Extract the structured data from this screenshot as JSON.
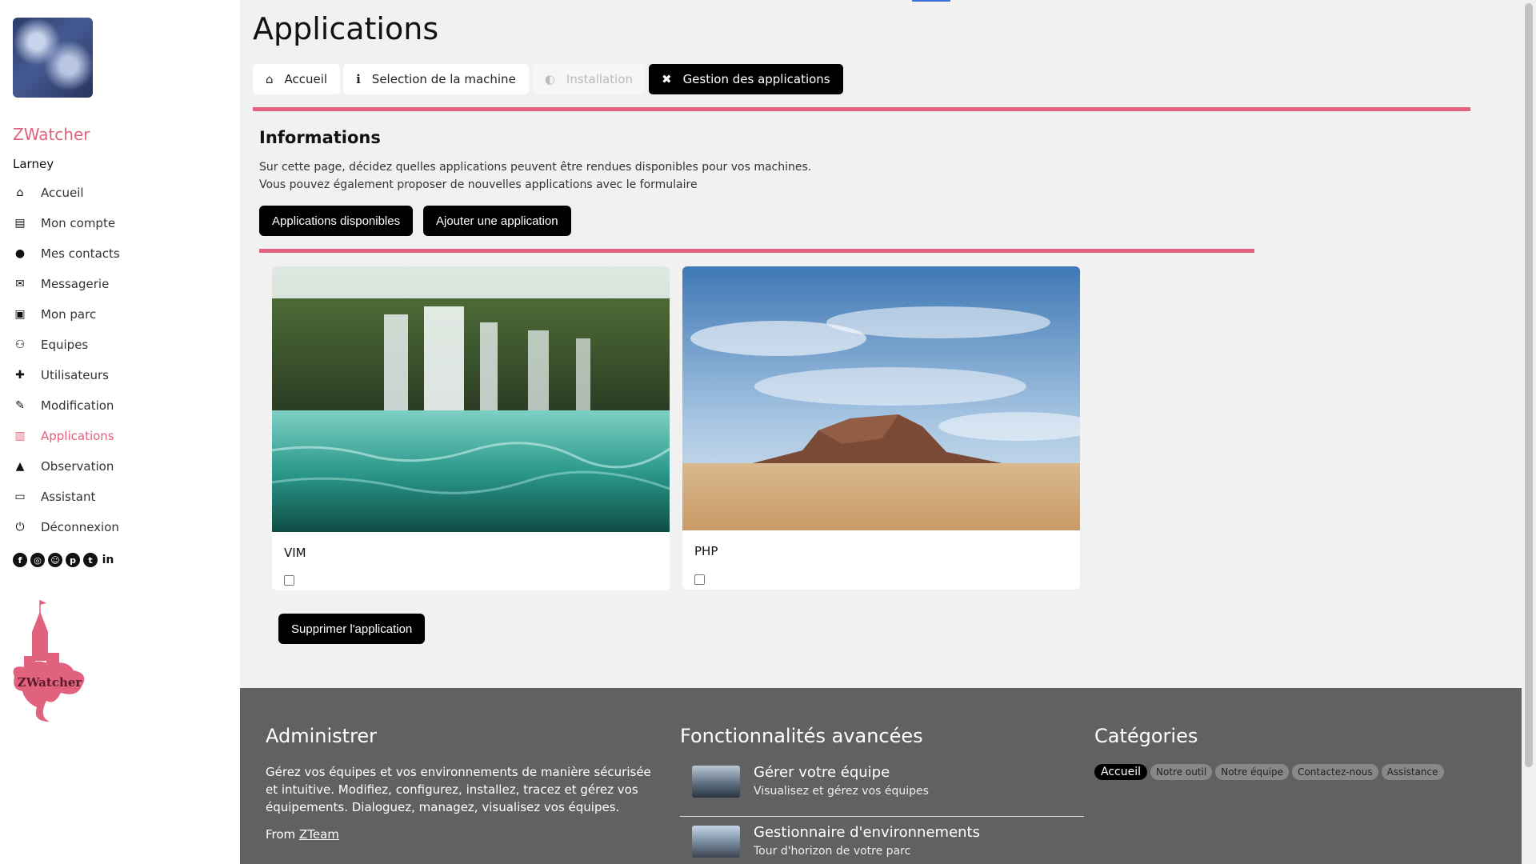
{
  "app": {
    "brand": "ZWatcher",
    "user": "Larney"
  },
  "sidebar": {
    "items": [
      {
        "label": "Accueil",
        "icon": "home-icon"
      },
      {
        "label": "Mon compte",
        "icon": "id-card-icon"
      },
      {
        "label": "Mes contacts",
        "icon": "user-icon"
      },
      {
        "label": "Messagerie",
        "icon": "envelope-icon"
      },
      {
        "label": "Mon parc",
        "icon": "book-icon"
      },
      {
        "label": "Equipes",
        "icon": "users-icon"
      },
      {
        "label": "Utilisateurs",
        "icon": "user-plus-icon"
      },
      {
        "label": "Modification",
        "icon": "pencil-icon"
      },
      {
        "label": "Applications",
        "icon": "map-icon",
        "active": true
      },
      {
        "label": "Observation",
        "icon": "building-icon"
      },
      {
        "label": "Assistant",
        "icon": "chalkboard-icon"
      },
      {
        "label": "Déconnexion",
        "icon": "power-icon"
      }
    ],
    "socials": [
      "facebook-icon",
      "instagram-icon",
      "snapchat-icon",
      "pinterest-icon",
      "twitter-icon",
      "linkedin-icon"
    ],
    "logo_text": "ZWatcher"
  },
  "page": {
    "title": "Applications",
    "tabs": [
      {
        "label": "Accueil",
        "icon": "home-icon"
      },
      {
        "label": "Selection de la machine",
        "icon": "info-icon"
      },
      {
        "label": "Installation",
        "icon": "globe-icon",
        "disabled": true
      },
      {
        "label": "Gestion des applications",
        "icon": "tools-icon",
        "active": true
      }
    ]
  },
  "info": {
    "title": "Informations",
    "line1": "Sur cette page, décidez quelles applications peuvent être rendues disponibles pour vos machines.",
    "line2": "Vous pouvez également proposer de nouvelles applications avec le formulaire",
    "btn_available": "Applications disponibles",
    "btn_add": "Ajouter une application"
  },
  "apps": [
    {
      "name": "VIM",
      "checked": false
    },
    {
      "name": "PHP",
      "checked": false
    }
  ],
  "delete_button": "Supprimer l'application",
  "footer": {
    "admin": {
      "title": "Administrer",
      "text": "Gérez vos équipes et vos environnements de manière sécurisée et intuitive. Modifiez, configurez, installez, tracez et gérez vos équipements. Dialoguez, managez, visualisez vos équipes.",
      "from_prefix": "From",
      "from_link": "ZTeam"
    },
    "features": {
      "title": "Fonctionnalités avancées",
      "items": [
        {
          "title": "Gérer votre équipe",
          "subtitle": "Visualisez et gérez vos équipes"
        },
        {
          "title": "Gestionnaire d'environnements",
          "subtitle": "Tour d'horizon de votre parc"
        }
      ]
    },
    "categories": {
      "title": "Catégories",
      "items": [
        "Accueil",
        "Notre outil",
        "Notre équipe",
        "Contactez-nous",
        "Assistance"
      ]
    }
  },
  "colors": {
    "accent": "#e0627d",
    "dark": "#000000",
    "footer_bg": "#616161"
  }
}
